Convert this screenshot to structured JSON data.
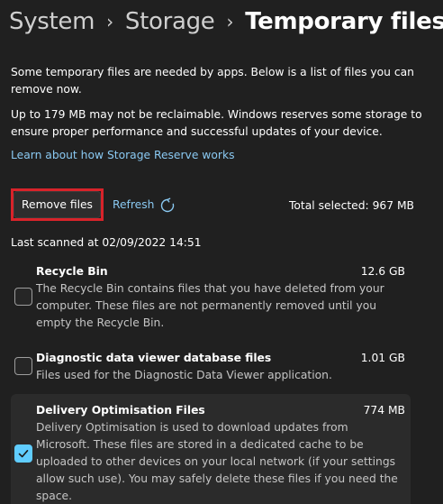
{
  "breadcrumb": {
    "items": [
      "System",
      "Storage",
      "Temporary files"
    ],
    "separator": "›"
  },
  "description": {
    "intro": "Some temporary files are needed by apps. Below is a list of files you can remove now.",
    "reserve": "Up to 179 MB may not be reclaimable. Windows reserves some storage to ensure proper performance and successful updates of your device."
  },
  "storage_reserve_link": "Learn about how Storage Reserve works",
  "toolbar": {
    "remove_label": "Remove files",
    "refresh_label": "Refresh",
    "total_selected": "Total selected: 967 MB"
  },
  "last_scanned": "Last scanned at 02/09/2022 14:51",
  "files": [
    {
      "name": "Recycle Bin",
      "size": "12.6 GB",
      "description": "The Recycle Bin contains files that you have deleted from your computer. These files are not permanently removed until you empty the Recycle Bin.",
      "checked": false
    },
    {
      "name": "Diagnostic data viewer database files",
      "size": "1.01 GB",
      "description": "Files used for the Diagnostic Data Viewer application.",
      "checked": false
    },
    {
      "name": "Delivery Optimisation Files",
      "size": "774 MB",
      "description": "Delivery Optimisation is used to download updates from Microsoft. These files are stored in a dedicated cache to be uploaded to other devices on your local network (if your settings allow such use). You may safely delete these files if you need the space.",
      "checked": true
    }
  ],
  "colors": {
    "background": "#202020",
    "link": "#8ac9f2",
    "accent": "#60cdff",
    "highlight_outline": "#d8232a"
  },
  "icons": {
    "refresh": "refresh-icon",
    "checkmark": "checkmark-icon"
  }
}
